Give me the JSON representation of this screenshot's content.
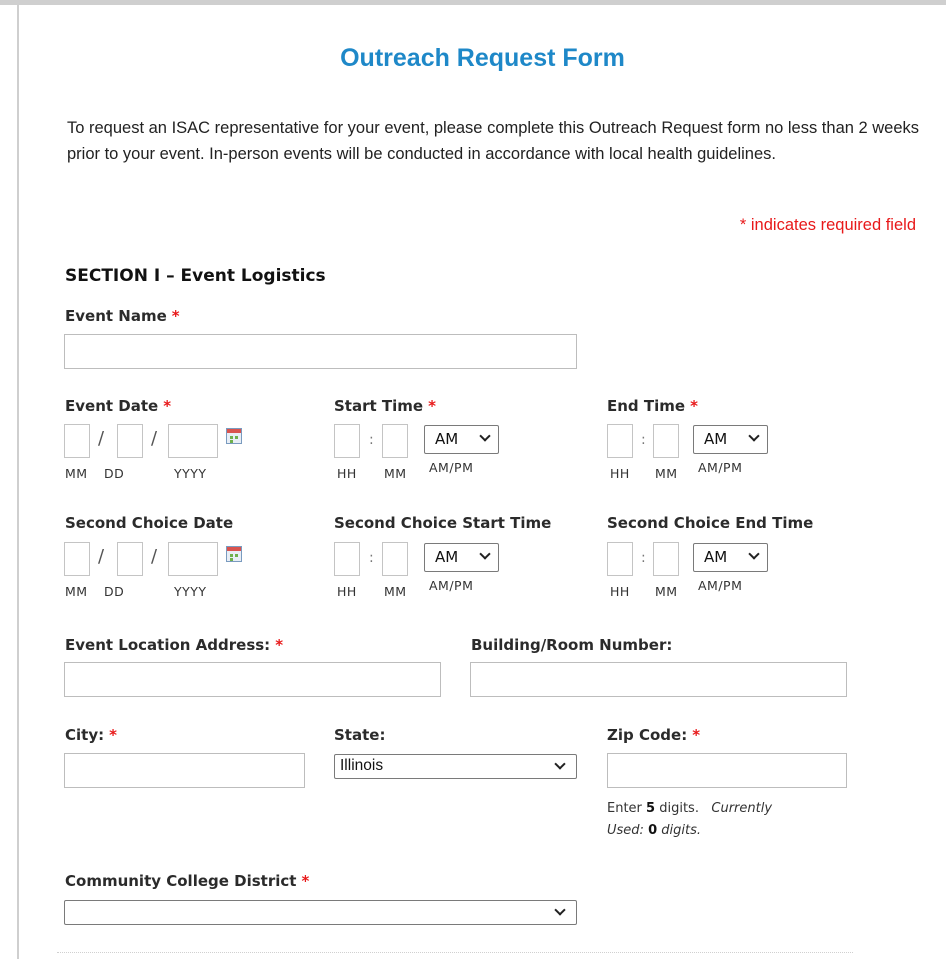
{
  "form": {
    "title": "Outreach Request Form",
    "intro": "To request an ISAC representative for your event, please complete this Outreach Request form no less than 2 weeks prior to your event. In-person events will be conducted in accordance with local health guidelines.",
    "required_note": "* indicates required field",
    "required_mark": "*",
    "section_title": "SECTION I – Event Logistics"
  },
  "fields": {
    "event_name": {
      "label": "Event Name",
      "value": ""
    },
    "event_date": {
      "label": "Event Date",
      "sub_labels": [
        "MM",
        "DD",
        "YYYY"
      ]
    },
    "start_time": {
      "label": "Start Time",
      "sub_labels": [
        "HH",
        "MM",
        "AM/PM"
      ],
      "ampm": "AM"
    },
    "end_time": {
      "label": "End Time",
      "sub_labels": [
        "HH",
        "MM",
        "AM/PM"
      ],
      "ampm": "AM"
    },
    "second_date": {
      "label": "Second Choice Date",
      "sub_labels": [
        "MM",
        "DD",
        "YYYY"
      ]
    },
    "second_start": {
      "label": "Second Choice Start Time",
      "sub_labels": [
        "HH",
        "MM",
        "AM/PM"
      ],
      "ampm": "AM"
    },
    "second_end": {
      "label": "Second Choice End Time",
      "sub_labels": [
        "HH",
        "MM",
        "AM/PM"
      ],
      "ampm": "AM"
    },
    "location": {
      "label": "Event Location Address:",
      "value": ""
    },
    "building": {
      "label": "Building/Room Number:",
      "value": ""
    },
    "city": {
      "label": "City:",
      "value": ""
    },
    "state": {
      "label": "State:",
      "selected": "Illinois"
    },
    "zip": {
      "label": "Zip Code:",
      "value": "",
      "help_enter": "Enter",
      "help_digits_required": "5",
      "help_digits_word": "digits.",
      "help_currently": "Currently",
      "help_used": "Used:",
      "help_used_count": "0",
      "help_used_digits": "digits."
    },
    "college_district": {
      "label": "Community College District",
      "selected": ""
    }
  },
  "separators": {
    "date": "/",
    "time": ":"
  },
  "colors": {
    "title": "#1e88c8",
    "required": "#e8191a",
    "input_border": "#bdbdbd"
  },
  "icons": {
    "calendar": "calendar-icon",
    "dropdown": "chevron-down-icon"
  }
}
